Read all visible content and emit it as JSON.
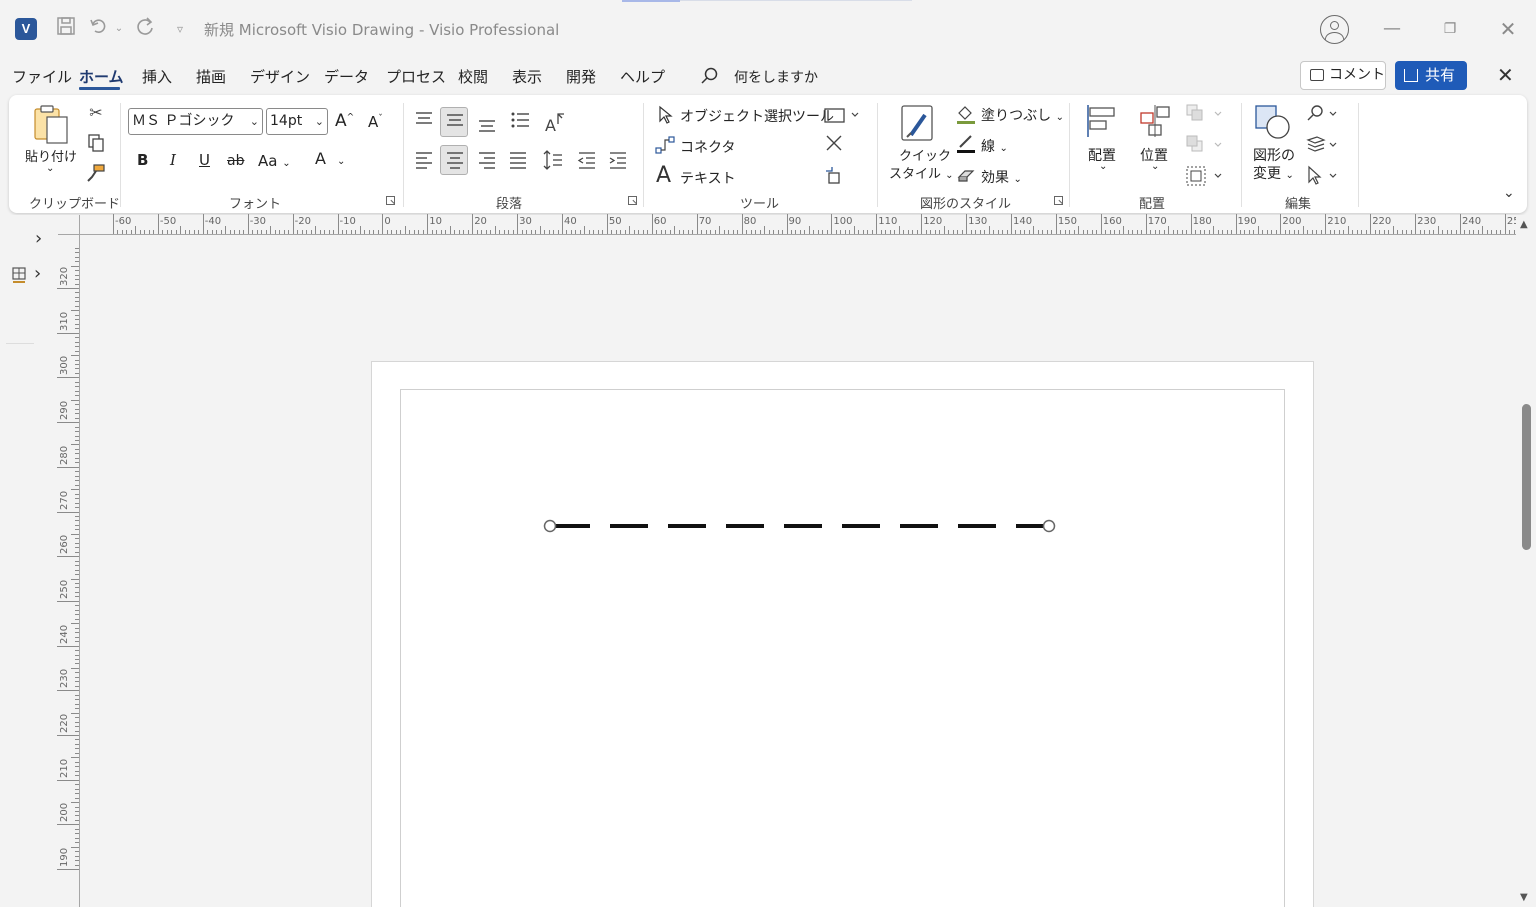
{
  "window": {
    "title": "新規 Microsoft Visio Drawing  -  Visio Professional",
    "app_icon_letter": "V"
  },
  "menu": {
    "tabs": [
      "ファイル",
      "ホーム",
      "挿入",
      "描画",
      "デザイン",
      "データ",
      "プロセス",
      "校閲",
      "表示",
      "開発",
      "ヘルプ"
    ],
    "active_tab": "ホーム",
    "search_placeholder": "何をしますか",
    "comment_label": "コメント",
    "share_label": "共有"
  },
  "ribbon": {
    "clipboard": {
      "label": "クリップボード",
      "paste": "貼り付け"
    },
    "font": {
      "label": "フォント",
      "font_name": "ＭＳ Ｐゴシック",
      "font_size": "14pt",
      "bold": "B",
      "italic": "I",
      "underline": "U",
      "strike": "ab",
      "case": "Aa",
      "font_color": "A"
    },
    "paragraph": {
      "label": "段落"
    },
    "tools": {
      "label": "ツール",
      "pointer": "オブジェクト選択ツール",
      "connector": "コネクタ",
      "text": "テキスト"
    },
    "shape_styles": {
      "label": "図形のスタイル",
      "quick_style_line1": "クイック",
      "quick_style_line2": "スタイル",
      "fill": "塗りつぶし",
      "line": "線",
      "effects": "効果"
    },
    "arrange": {
      "label": "配置",
      "align": "配置",
      "position": "位置"
    },
    "editing": {
      "label": "編集",
      "change_shape_line1": "図形の",
      "change_shape_line2": "変更"
    }
  },
  "ruler": {
    "horizontal_labels": [
      "-60",
      "-50",
      "-40",
      "-30",
      "-20",
      "-10",
      "0",
      "10",
      "20",
      "30",
      "40",
      "50",
      "60",
      "70",
      "80",
      "90",
      "100",
      "110",
      "120",
      "130",
      "140",
      "150",
      "160",
      "170",
      "180",
      "190",
      "200",
      "210",
      "220",
      "230",
      "240",
      "250"
    ],
    "vertical_labels": [
      "320",
      "310",
      "300",
      "290",
      "280",
      "270",
      "260",
      "250",
      "240",
      "230",
      "220",
      "210",
      "200",
      "190",
      "180"
    ]
  },
  "drawing": {
    "shape": "dashed-line",
    "stroke_color": "#111111"
  },
  "colors": {
    "accent": "#2b579a",
    "share_button": "#1f5bb8"
  }
}
